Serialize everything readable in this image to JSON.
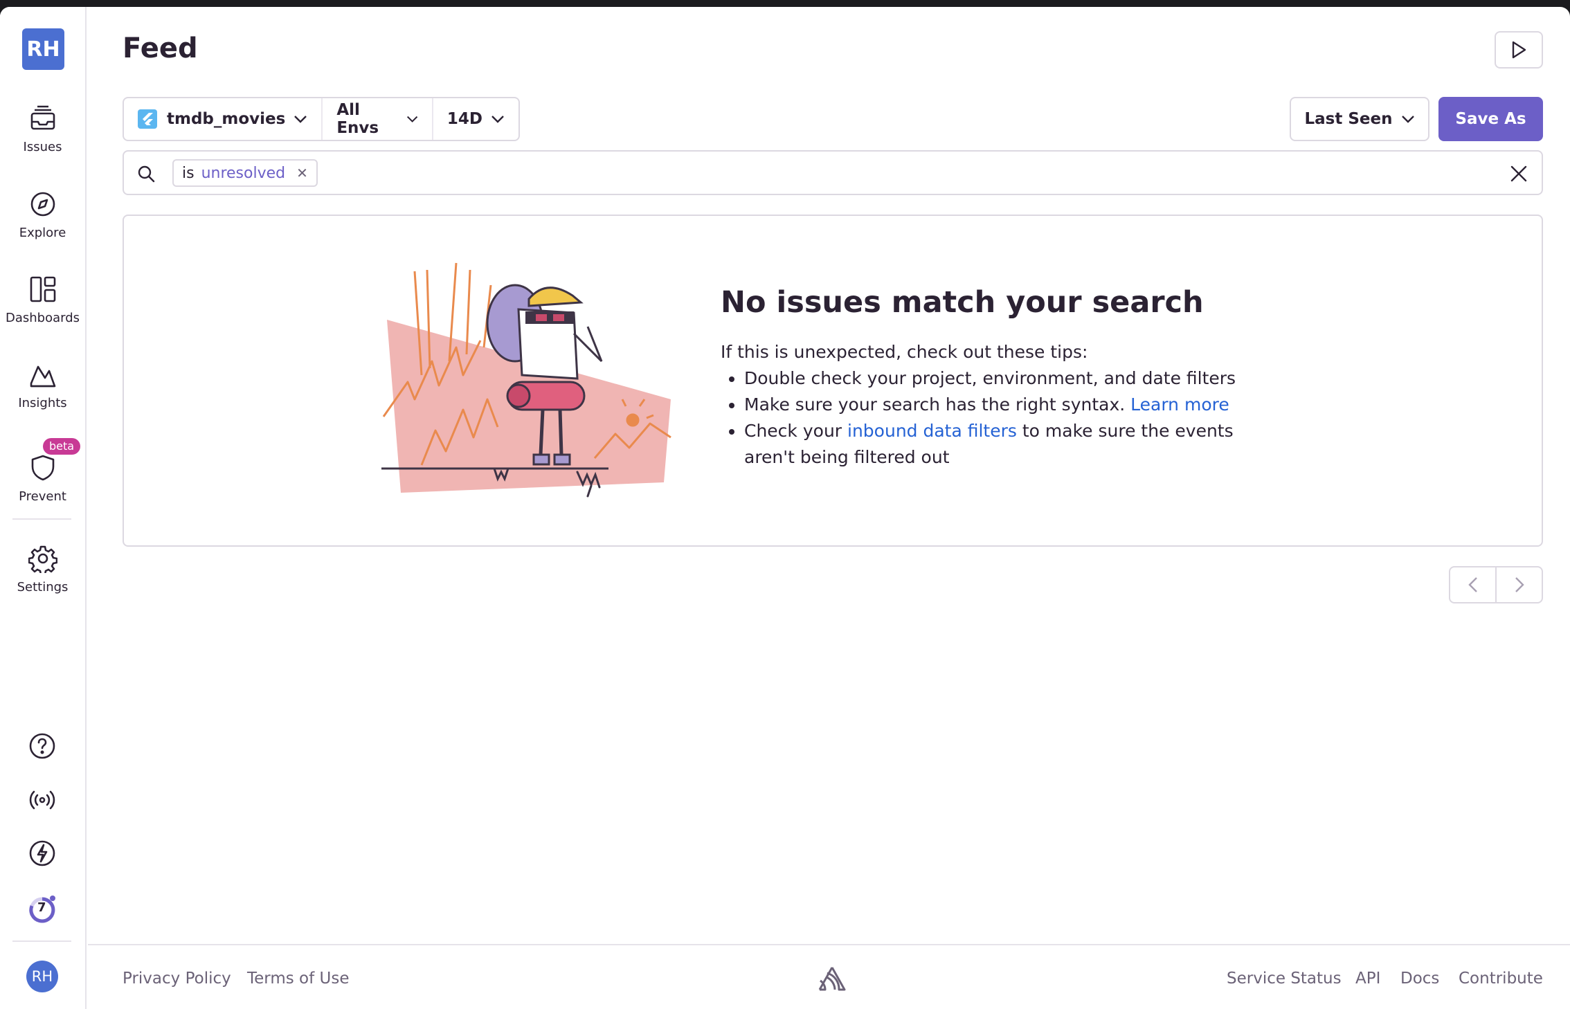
{
  "org": {
    "avatar_initials": "RH"
  },
  "sidebar": {
    "items": [
      {
        "label": "Issues",
        "icon": "issues-icon"
      },
      {
        "label": "Explore",
        "icon": "compass-icon"
      },
      {
        "label": "Dashboards",
        "icon": "dashboards-icon"
      },
      {
        "label": "Insights",
        "icon": "insights-icon"
      },
      {
        "label": "Prevent",
        "icon": "shield-icon",
        "badge": "beta"
      },
      {
        "label": "Settings",
        "icon": "gear-icon"
      }
    ],
    "bottom_icons": [
      "help-icon",
      "broadcast-icon",
      "lightning-icon",
      "onboarding-progress-icon"
    ],
    "onboarding_count": "7",
    "user_initials": "RH"
  },
  "header": {
    "title": "Feed"
  },
  "filters": {
    "project": "tmdb_movies",
    "environment": "All Envs",
    "date_range": "14D",
    "sort": "Last Seen",
    "save_label": "Save As"
  },
  "search": {
    "token_key": "is",
    "token_value": "unresolved"
  },
  "empty_state": {
    "title": "No issues match your search",
    "intro": "If this is unexpected, check out these tips:",
    "tip1": "Double check your project, environment, and date filters",
    "tip2_text": "Make sure your search has the right syntax. ",
    "tip2_link": "Learn more",
    "tip3_pre": "Check your ",
    "tip3_link": "inbound data filters",
    "tip3_post": " to make sure the events aren't being filtered out"
  },
  "footer": {
    "privacy": "Privacy Policy",
    "terms": "Terms of Use",
    "service_status": "Service Status",
    "api": "API",
    "docs": "Docs",
    "contribute": "Contribute"
  },
  "colors": {
    "accent": "#6c5fc7",
    "avatar": "#4b6fd1",
    "link": "#2562d4",
    "beta": "#c83a95"
  }
}
